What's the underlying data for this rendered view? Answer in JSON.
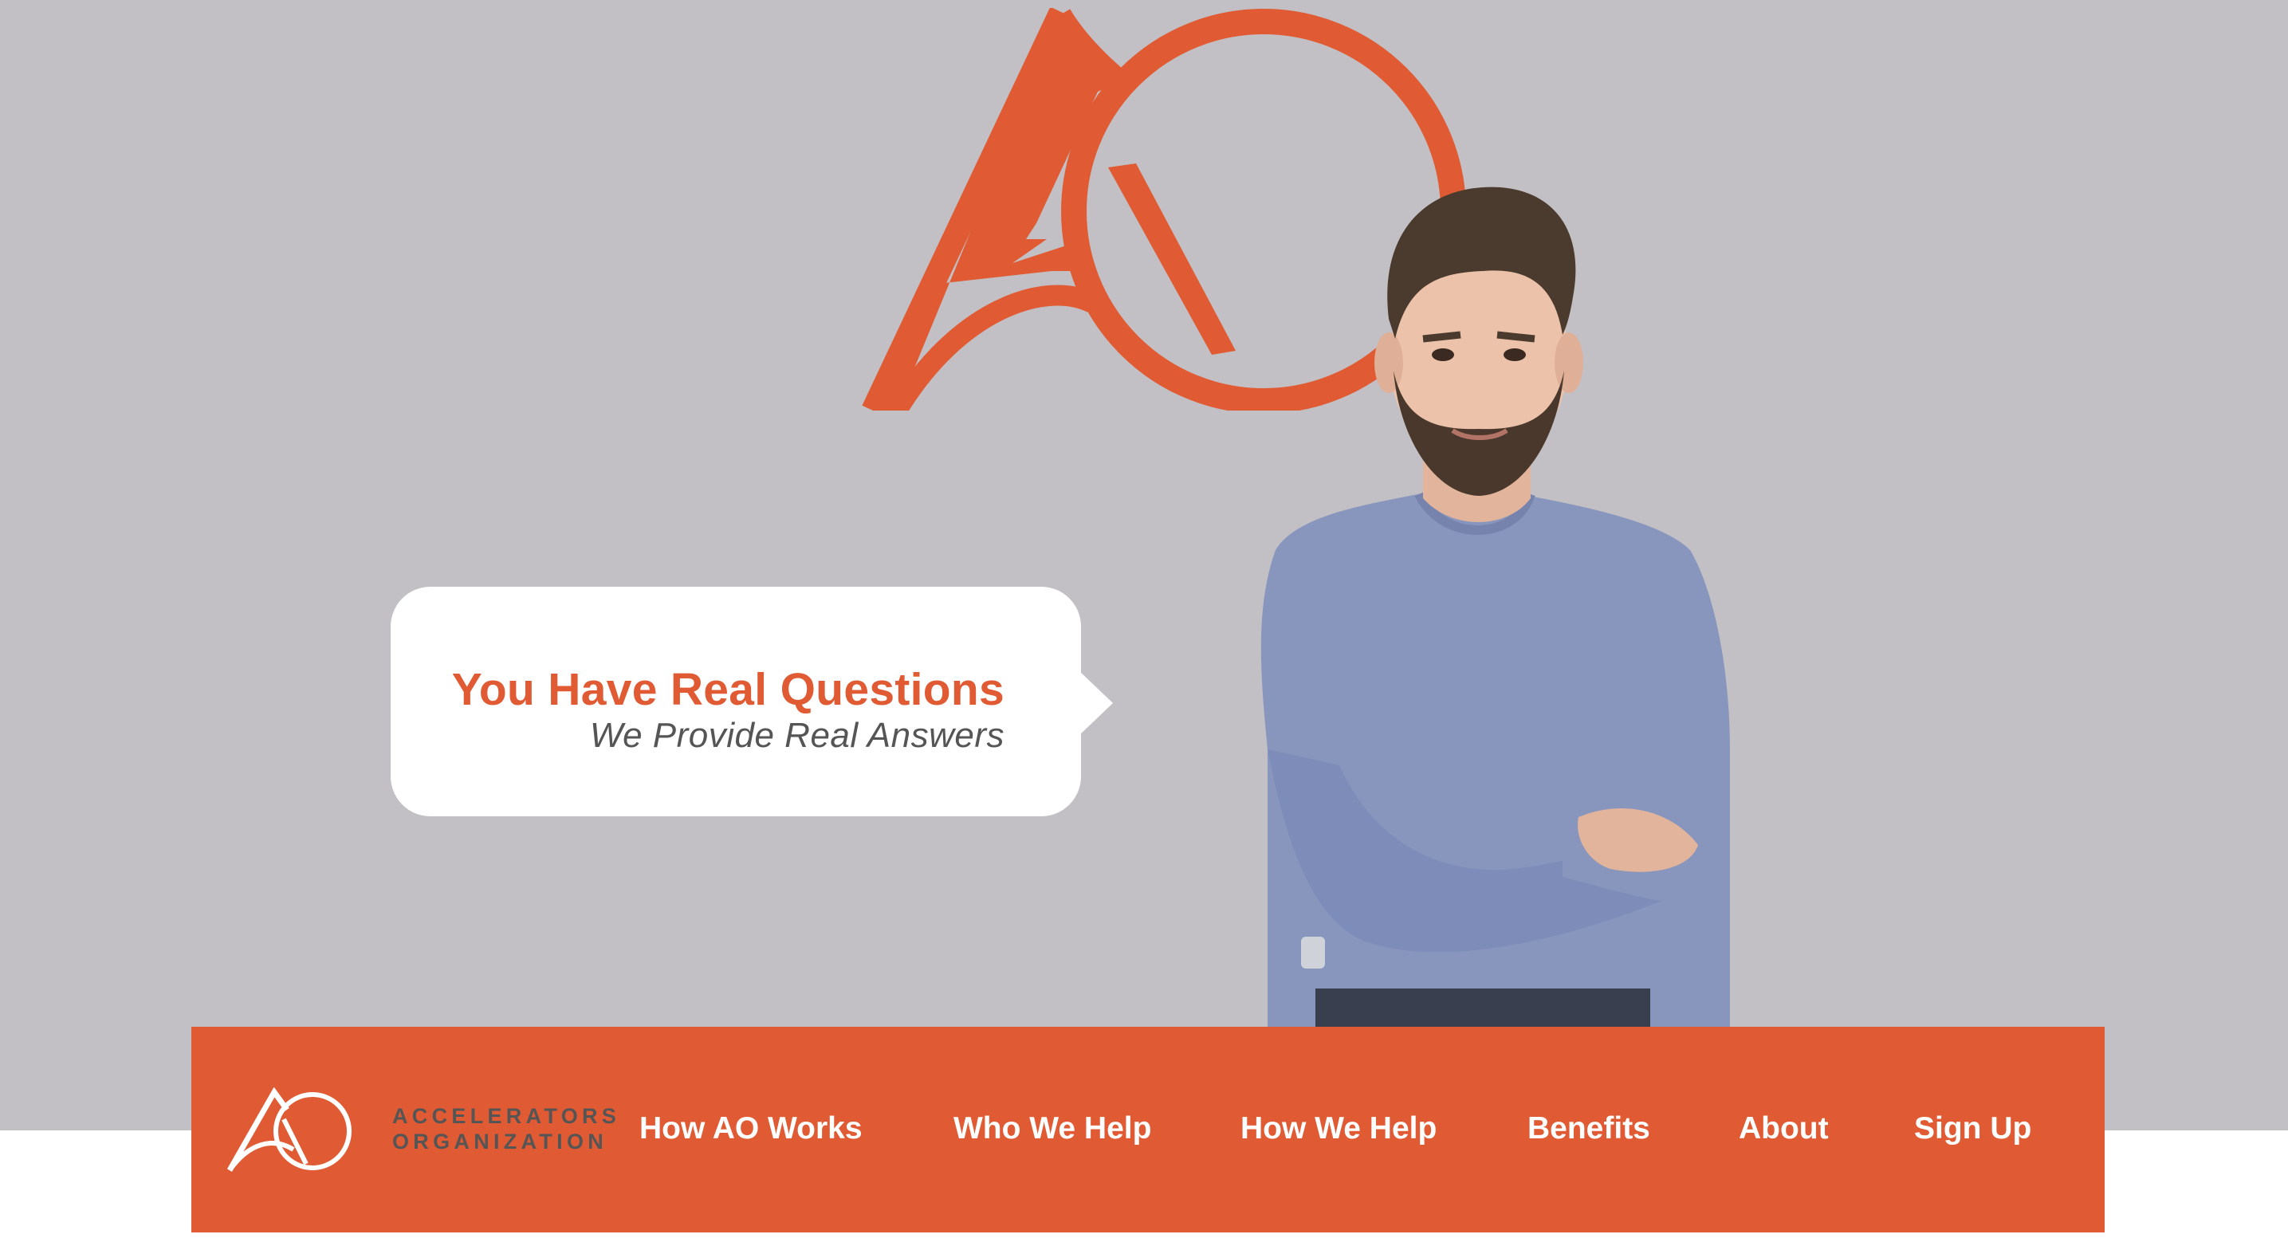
{
  "hero": {
    "headline": "You Have Real Questions",
    "subheadline": "We Provide Real Answers",
    "background_color": "#c2c0c4",
    "accent_color": "#e05b33"
  },
  "navbar": {
    "background_color": "#e05b33",
    "logo": {
      "icon": "ao-logo-icon",
      "line1": "ACCELERATORS",
      "line2": "ORGANIZATION"
    },
    "items": [
      {
        "label": "How AO Works"
      },
      {
        "label": "Who We Help"
      },
      {
        "label": "How We Help"
      },
      {
        "label": "Benefits"
      },
      {
        "label": "About"
      },
      {
        "label": "Sign Up"
      }
    ]
  }
}
